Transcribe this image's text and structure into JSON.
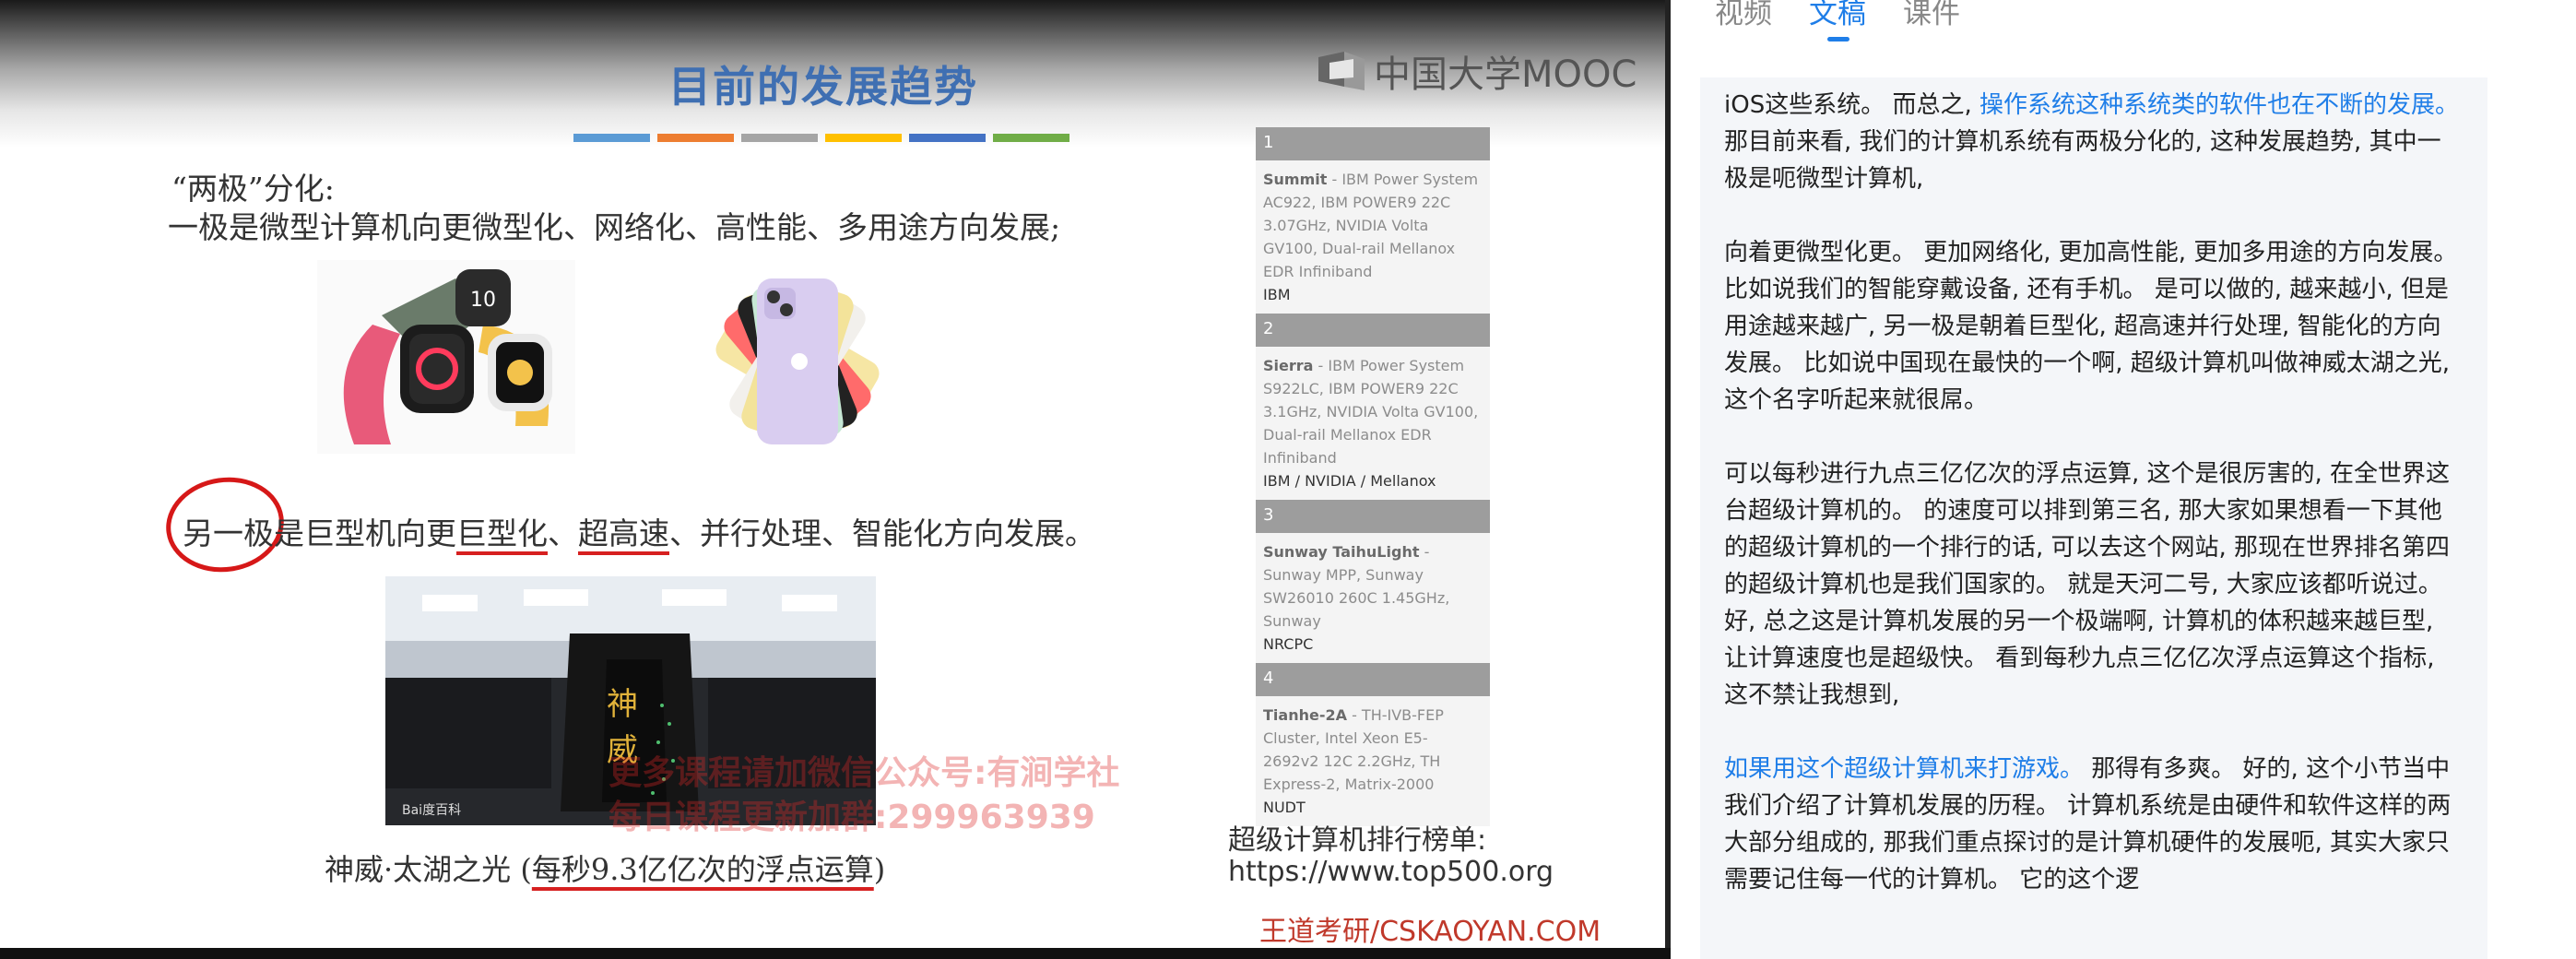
{
  "slide": {
    "title": "目前的发展趋势",
    "logo_text": "中国大学MOOC",
    "color_bars": [
      "#5b9bd5",
      "#ed7d31",
      "#a5a5a5",
      "#ffc000",
      "#4472c4",
      "#70ad47"
    ],
    "line1": "“两极”分化:",
    "line2": "一极是微型计算机向更微型化、网络化、高性能、多用途方向发展;",
    "line3_a": "另一极",
    "line3_b": "是巨型机向更",
    "line3_c": "巨型化",
    "line3_d": "、",
    "line3_e": "超高速",
    "line3_f": "、并行处理、智能化方向发展。",
    "supercomputer_char1": "神",
    "supercomputer_char2": "威",
    "baidu_mark": "Bai度百科",
    "caption_a": "神威·太湖之光 (",
    "caption_b": "每秒9.3亿亿次的浮点运算",
    "caption_c": ")",
    "watermark1": "更多课程请加微信公众号:有涧学社",
    "watermark2": "每日课程更新加群:299963939",
    "top500_label": "超级计算机排行榜单:",
    "top500_url": "https://www.top500.org",
    "footer": "王道考研/CSKAOYAN.COM",
    "top500": [
      {
        "rank": "1",
        "name": "Summit",
        "desc": " - IBM Power System AC922, IBM POWER9 22C 3.07GHz, NVIDIA Volta GV100, Dual-rail Mellanox EDR Infiniband",
        "vendor": "IBM"
      },
      {
        "rank": "2",
        "name": "Sierra",
        "desc": " - IBM Power System S922LC, IBM POWER9 22C 3.1GHz, NVIDIA Volta GV100, Dual-rail Mellanox EDR Infiniband",
        "vendor": "IBM / NVIDIA / Mellanox"
      },
      {
        "rank": "3",
        "name": "Sunway TaihuLight",
        "desc": " - Sunway MPP, Sunway SW26010 260C 1.45GHz, Sunway",
        "vendor": "NRCPC"
      },
      {
        "rank": "4",
        "name": "Tianhe-2A",
        "desc": " - TH-IVB-FEP Cluster, Intel Xeon E5-2692v2 12C 2.2GHz, TH Express-2, Matrix-2000",
        "vendor": "NUDT"
      }
    ]
  },
  "panel": {
    "tabs": [
      {
        "label": "视频",
        "active": false
      },
      {
        "label": "文稿",
        "active": true
      },
      {
        "label": "课件",
        "active": false
      }
    ],
    "p1_a": "iOS这些系统。 而总之, ",
    "p1_hl": "操作系统这种系统类的软件也在不断的发展。",
    "p1_b": " 那目前来看, 我们的计算机系统有两极分化的, 这种发展趋势, 其中一极是呃微型计算机,",
    "p2": "向着更微型化更。 更加网络化, 更加高性能, 更加多用途的方向发展。 比如说我们的智能穿戴设备, 还有手机。 是可以做的, 越来越小, 但是用途越来越广, 另一极是朝着巨型化, 超高速并行处理, 智能化的方向发展。 比如说中国现在最快的一个啊, 超级计算机叫做神威太湖之光, 这个名字听起来就很屌。",
    "p3": "可以每秒进行九点三亿亿次的浮点运算, 这个是很厉害的, 在全世界这台超级计算机的。 的速度可以排到第三名, 那大家如果想看一下其他的超级计算机的一个排行的话, 可以去这个网站, 那现在世界排名第四的超级计算机也是我们国家的。 就是天河二号, 大家应该都听说过。 好, 总之这是计算机发展的另一个极端啊, 计算机的体积越来越巨型, 让计算速度也是超级快。 看到每秒九点三亿亿次浮点运算这个指标, 这不禁让我想到,",
    "p4_hl": "如果用这个超级计算机来打游戏。",
    "p4_b": " 那得有多爽。 好的, 这个小节当中我们介绍了计算机发展的历程。 计算机系统是由硬件和软件这样的两大部分组成的, 那我们重点探讨的是计算机硬件的发展呃, 其实大家只需要记住每一代的计算机。 它的这个逻"
  }
}
